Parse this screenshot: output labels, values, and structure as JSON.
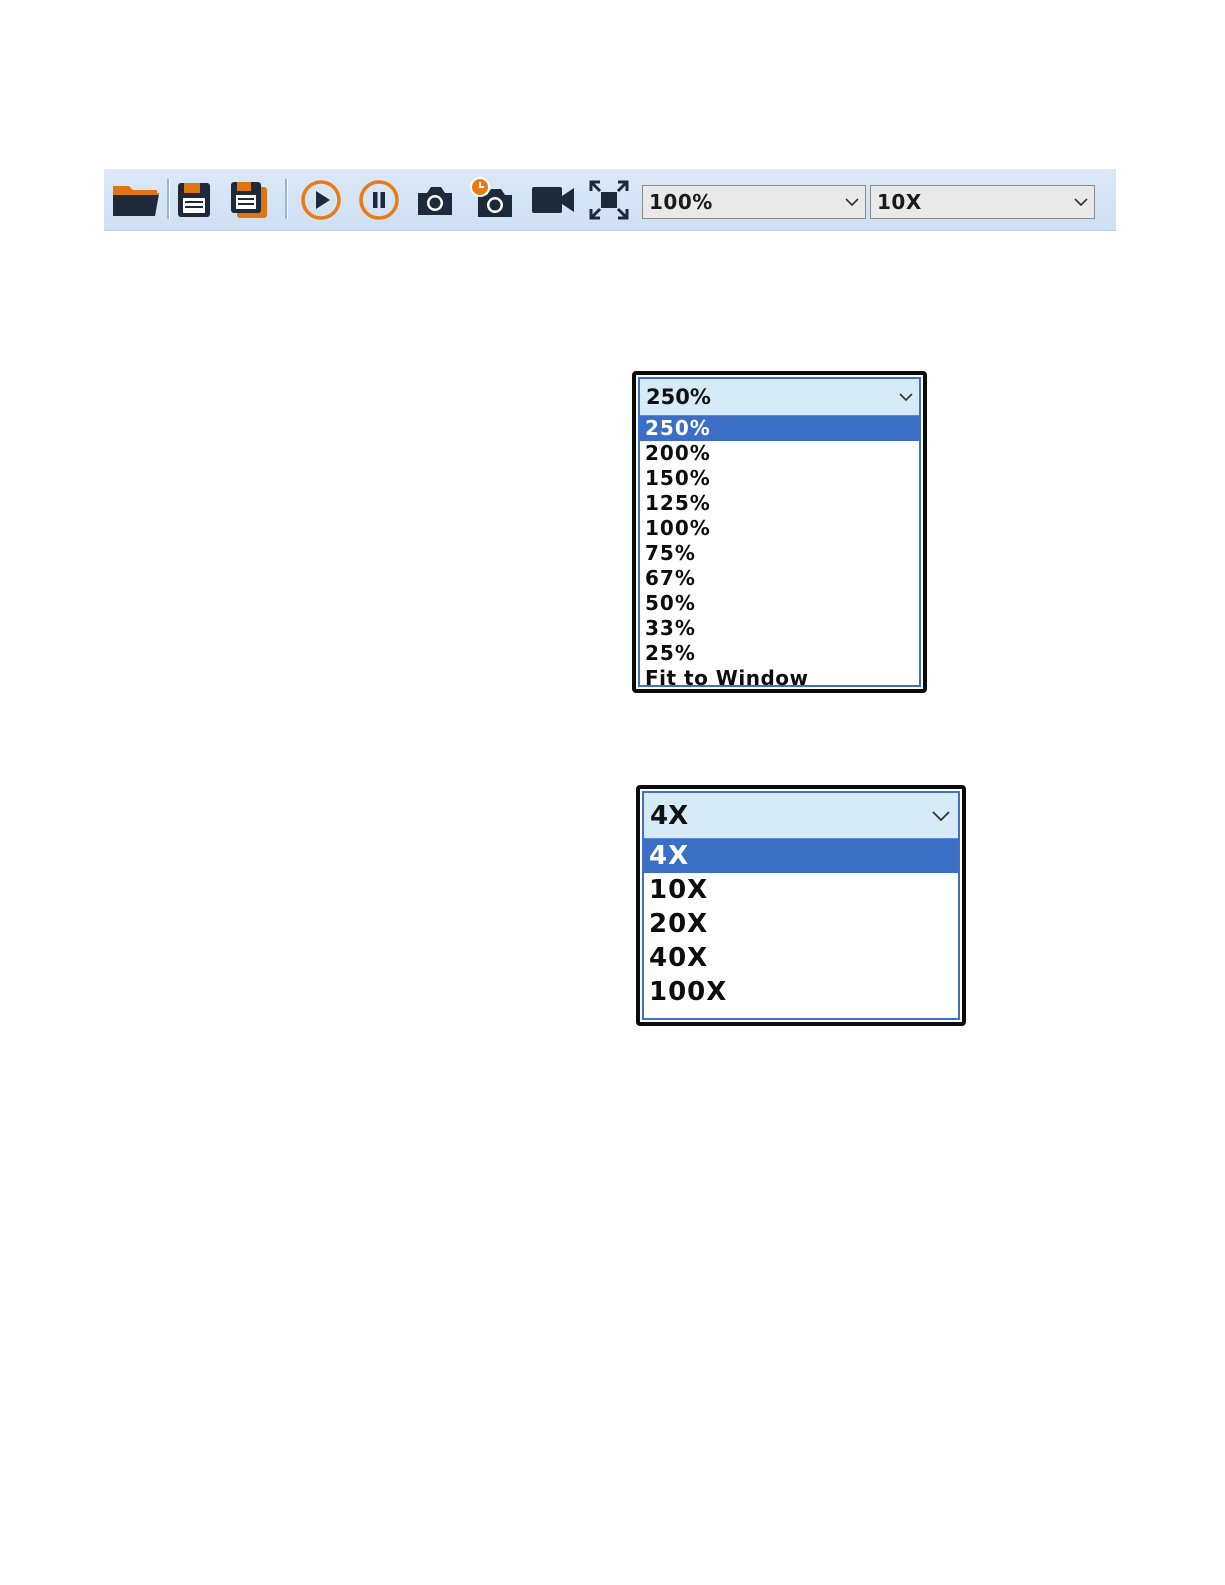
{
  "toolbar": {
    "buttons": [
      {
        "name": "open-folder-button",
        "icon": "folder-open-icon"
      },
      {
        "name": "save-button",
        "icon": "floppy-disk-icon"
      },
      {
        "name": "save-as-button",
        "icon": "floppy-disk-multiple-icon"
      },
      {
        "name": "play-button",
        "icon": "play-circle-icon"
      },
      {
        "name": "pause-button",
        "icon": "pause-circle-icon"
      },
      {
        "name": "snapshot-button",
        "icon": "camera-icon"
      },
      {
        "name": "timed-snapshot-button",
        "icon": "camera-timer-icon"
      },
      {
        "name": "record-video-button",
        "icon": "video-camera-icon"
      },
      {
        "name": "fullscreen-button",
        "icon": "expand-icon"
      }
    ],
    "zoom_value": "100%",
    "magnification_value": "10X"
  },
  "zoom_dropdown": {
    "selected": "250%",
    "options": [
      "250%",
      "200%",
      "150%",
      "125%",
      "100%",
      "75%",
      "67%",
      "50%",
      "33%",
      "25%",
      "Fit to Window"
    ]
  },
  "magnification_dropdown": {
    "selected": "4X",
    "options": [
      "4X",
      "10X",
      "20X",
      "40X",
      "100X"
    ]
  },
  "colors": {
    "toolbar_bg": "#d4e4f5",
    "accent_orange": "#ea7b14",
    "icon_dark": "#1e2a3a",
    "selection_blue": "#3b6fc5",
    "header_bg": "#d6eaf8"
  }
}
